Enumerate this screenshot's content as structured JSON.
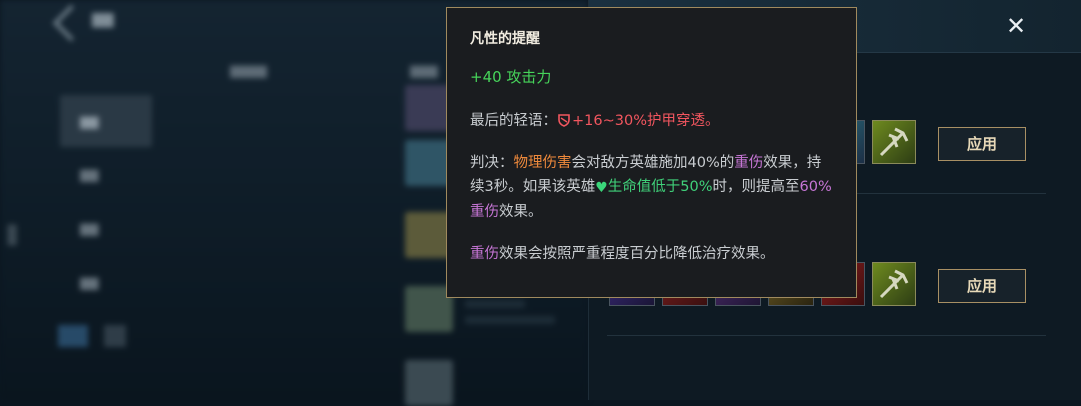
{
  "background": {
    "close_icon": "close-icon",
    "apply_buttons": [
      "应用",
      "应用"
    ]
  },
  "tooltip": {
    "title": "凡性的提醒",
    "stat": "+40 攻击力",
    "para1": {
      "label": "最后的轻语：",
      "value": "+16~30%护甲穿透。"
    },
    "para2": {
      "part1": "判决：",
      "physical": "物理伤害",
      "part2": "会对敌方英雄施加40%的",
      "grievous1": "重伤",
      "part3": "效果，持续3秒。如果该英雄",
      "health": "生命值低于50%",
      "part4": "时，则提高至",
      "sixty": "60%",
      "grievous2": "重伤",
      "part5": "效果。"
    },
    "para3": {
      "grievous": "重伤",
      "rest": "效果会按照严重程度百分比降低治疗效果。"
    }
  },
  "colors": {
    "border_gold": "#a08a5e",
    "stat_green": "#46d45a",
    "keyword_orange": "#f08a3c",
    "keyword_purple": "#c776d6",
    "keyword_red": "#f2565f",
    "health_green": "#40d17a"
  }
}
